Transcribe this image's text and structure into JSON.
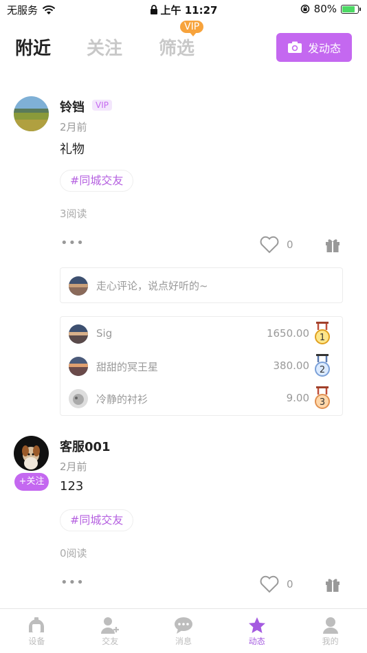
{
  "status_bar": {
    "carrier": "无服务",
    "time": "上午 11:27",
    "battery": "80%",
    "battery_level": 0.8
  },
  "header": {
    "tabs": [
      {
        "label": "附近",
        "active": true
      },
      {
        "label": "关注",
        "active": false
      },
      {
        "label": "筛选",
        "active": false
      }
    ],
    "vip_badge": "VIP",
    "post_button": "发动态"
  },
  "posts": [
    {
      "username": "铃铛",
      "vip_tag": "VIP",
      "time": "2月前",
      "content": "礼物",
      "topic": "#同城交友",
      "reads": "3阅读",
      "likes": "0",
      "comment_placeholder": "走心评论，说点好听的~",
      "gifts": [
        {
          "name": "Sig",
          "value": "1650.00",
          "rank": "1"
        },
        {
          "name": "甜甜的冥王星",
          "value": "380.00",
          "rank": "2"
        },
        {
          "name": "冷静的衬衫",
          "value": "9.00",
          "rank": "3"
        }
      ]
    },
    {
      "username": "客服001",
      "follow_label": "+关注",
      "time": "2月前",
      "content": "123",
      "topic": "#同城交友",
      "reads": "0阅读",
      "likes": "0"
    }
  ],
  "tabbar": {
    "items": [
      {
        "label": "设备",
        "icon": "device-icon",
        "active": false
      },
      {
        "label": "交友",
        "icon": "add-friend-icon",
        "active": false
      },
      {
        "label": "消息",
        "icon": "message-icon",
        "active": false
      },
      {
        "label": "动态",
        "icon": "star-icon",
        "active": true
      },
      {
        "label": "我的",
        "icon": "profile-icon",
        "active": false
      }
    ]
  },
  "colors": {
    "accent": "#c468f0",
    "vip_orange": "#f7a33c",
    "tab_active": "#a45ae0"
  }
}
